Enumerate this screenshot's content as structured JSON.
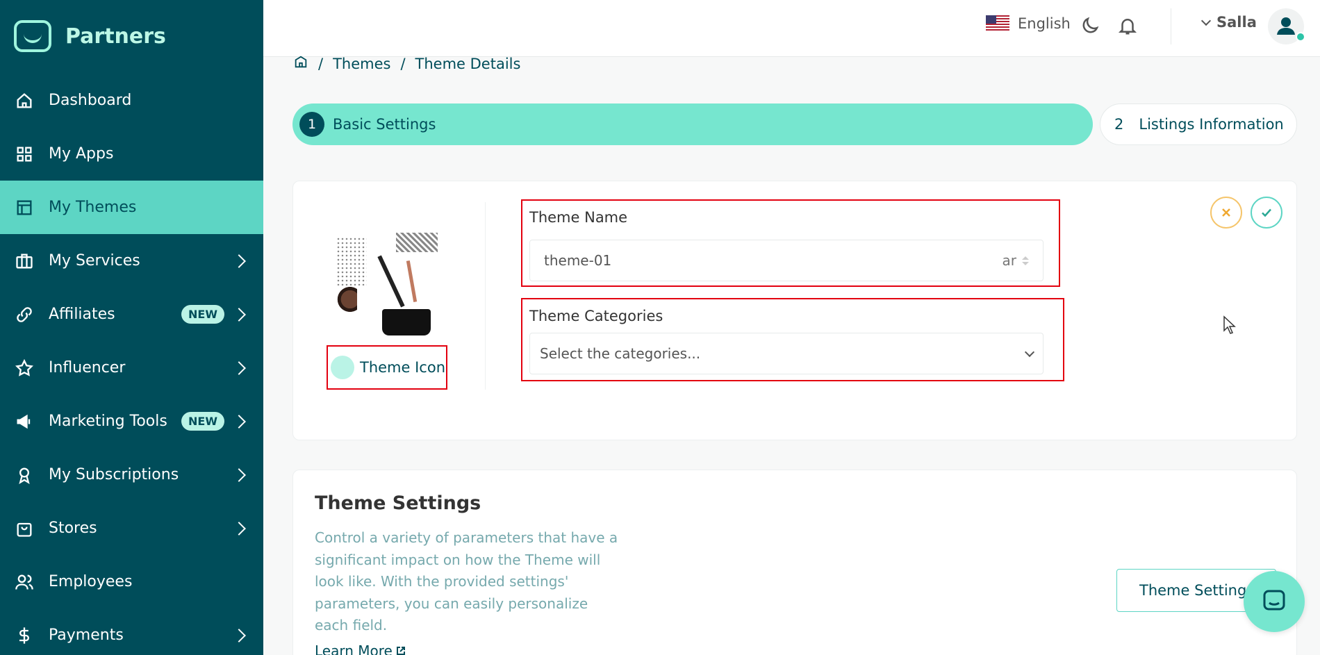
{
  "sidebar": {
    "brand": "Partners",
    "items": [
      {
        "label": "Dashboard",
        "icon": "home-icon",
        "active": false,
        "chevron": false,
        "badge": ""
      },
      {
        "label": "My Apps",
        "icon": "grid-icon",
        "active": false,
        "chevron": false,
        "badge": ""
      },
      {
        "label": "My Themes",
        "icon": "layout-icon",
        "active": true,
        "chevron": false,
        "badge": ""
      },
      {
        "label": "My Services",
        "icon": "briefcase-icon",
        "active": false,
        "chevron": true,
        "badge": ""
      },
      {
        "label": "Affiliates",
        "icon": "link-icon",
        "active": false,
        "chevron": true,
        "badge": "NEW"
      },
      {
        "label": "Influencer",
        "icon": "star-icon",
        "active": false,
        "chevron": true,
        "badge": ""
      },
      {
        "label": "Marketing Tools",
        "icon": "megaphone-icon",
        "active": false,
        "chevron": true,
        "badge": "NEW"
      },
      {
        "label": "My Subscriptions",
        "icon": "award-icon",
        "active": false,
        "chevron": true,
        "badge": ""
      },
      {
        "label": "Stores",
        "icon": "shopping-bag-icon",
        "active": false,
        "chevron": true,
        "badge": ""
      },
      {
        "label": "Employees",
        "icon": "users-icon",
        "active": false,
        "chevron": false,
        "badge": ""
      },
      {
        "label": "Payments",
        "icon": "dollar-icon",
        "active": false,
        "chevron": true,
        "badge": ""
      }
    ]
  },
  "header": {
    "language": "English",
    "user_name": "Salla"
  },
  "breadcrumb": {
    "items": [
      "Themes",
      "Theme Details"
    ]
  },
  "steps": {
    "active_number": "1",
    "active_label": "Basic Settings",
    "next_number": "2",
    "next_label": "Listings Information"
  },
  "basic": {
    "theme_icon_label": "Theme Icon",
    "theme_name_label": "Theme Name",
    "theme_name_value": "theme-01",
    "theme_name_lang": "ar",
    "categories_label": "Theme Categories",
    "categories_placeholder": "Select the categories..."
  },
  "settings_card": {
    "title": "Theme Settings",
    "description": "Control a variety of parameters that have a significant impact on how the Theme will look like. With the provided settings' parameters, you can easily personalize each field.",
    "learn_more": "Learn More",
    "button_label": "Theme Settings"
  },
  "colors": {
    "sidebar_bg": "#004d5a",
    "accent": "#76e6cf",
    "highlight_border": "#e3000f"
  }
}
